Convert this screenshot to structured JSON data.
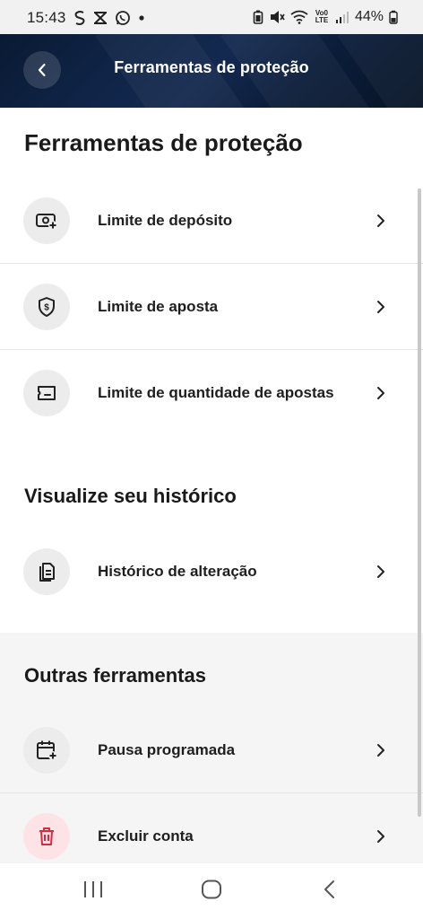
{
  "status_bar": {
    "time": "15:43",
    "battery": "44%",
    "left_icons": [
      "s-icon",
      "notification-icon",
      "whatsapp-icon",
      "dot-icon"
    ],
    "right_icons": [
      "battery-saver-icon",
      "mute-icon",
      "wifi-icon",
      "volte-icon",
      "signal-icon",
      "battery-icon"
    ],
    "volte_text": "Vo0 LTE"
  },
  "header": {
    "title": "Ferramentas de proteção",
    "back_icon": "chevron-left-icon"
  },
  "sections": [
    {
      "title": "Ferramentas de proteção",
      "items": [
        {
          "label": "Limite de depósito",
          "icon": "deposit-money-icon"
        },
        {
          "label": "Limite de aposta",
          "icon": "shield-dollar-icon"
        },
        {
          "label": "Limite de quantidade de apostas",
          "icon": "ticket-icon"
        }
      ]
    },
    {
      "title": "Visualize seu histórico",
      "items": [
        {
          "label": "Histórico de alteração",
          "icon": "document-history-icon"
        }
      ]
    },
    {
      "title": "Outras ferramentas",
      "items": [
        {
          "label": "Pausa programada",
          "icon": "calendar-add-icon"
        },
        {
          "label": "Excluir conta",
          "icon": "trash-icon"
        }
      ]
    }
  ],
  "colors": {
    "header_bg": "#0f2447",
    "danger_icon": "#d92b3f",
    "danger_bg": "#fde3e6"
  }
}
